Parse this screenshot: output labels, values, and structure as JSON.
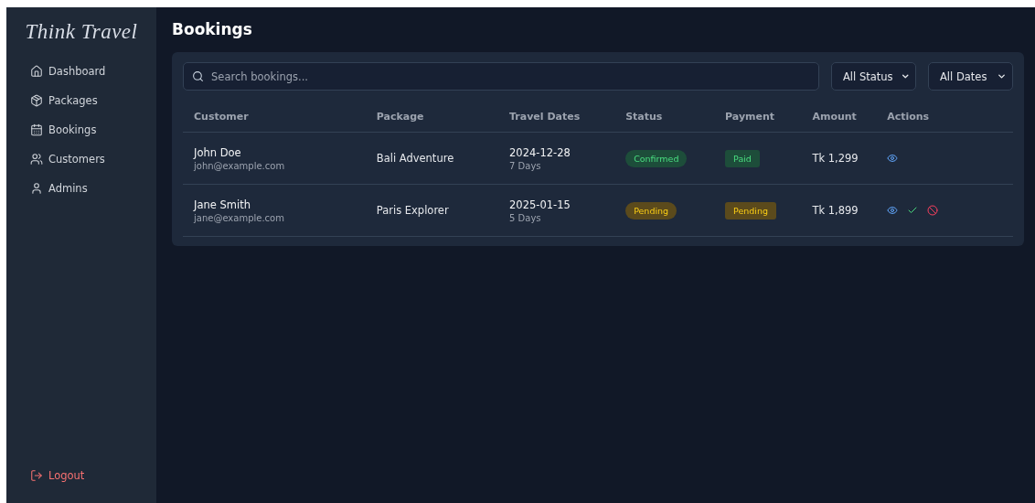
{
  "sidebar": {
    "logo": "Think Travel",
    "items": [
      {
        "label": "Dashboard"
      },
      {
        "label": "Packages"
      },
      {
        "label": "Bookings"
      },
      {
        "label": "Customers"
      },
      {
        "label": "Admins"
      }
    ],
    "logout": "Logout"
  },
  "page": {
    "title": "Bookings"
  },
  "filters": {
    "search": {
      "placeholder": "Search bookings..."
    },
    "selects": [
      "All Status",
      "All Dates"
    ]
  },
  "table": {
    "columns": [
      "Customer",
      "Package",
      "Travel Dates",
      "Status",
      "Payment",
      "Amount",
      "Actions"
    ],
    "rows": [
      {
        "name": "John Doe",
        "email": "john@example.com",
        "package": "Bali Adventure",
        "date": "2024-12-28",
        "duration": "7 Days",
        "status": {
          "label": "Confirmed",
          "kind": "success"
        },
        "payment": {
          "label": "Paid",
          "kind": "success"
        },
        "amount": "Tk 1,299",
        "actions": [
          {
            "kind": "view"
          }
        ]
      },
      {
        "name": "Jane Smith",
        "email": "jane@example.com",
        "package": "Paris Explorer",
        "date": "2025-01-15",
        "duration": "5 Days",
        "status": {
          "label": "Pending",
          "kind": "warning"
        },
        "payment": {
          "label": "Pending",
          "kind": "warning"
        },
        "amount": "Tk 1,899",
        "actions": [
          {
            "kind": "view"
          },
          {
            "kind": "approve"
          },
          {
            "kind": "cancel"
          }
        ]
      }
    ]
  }
}
